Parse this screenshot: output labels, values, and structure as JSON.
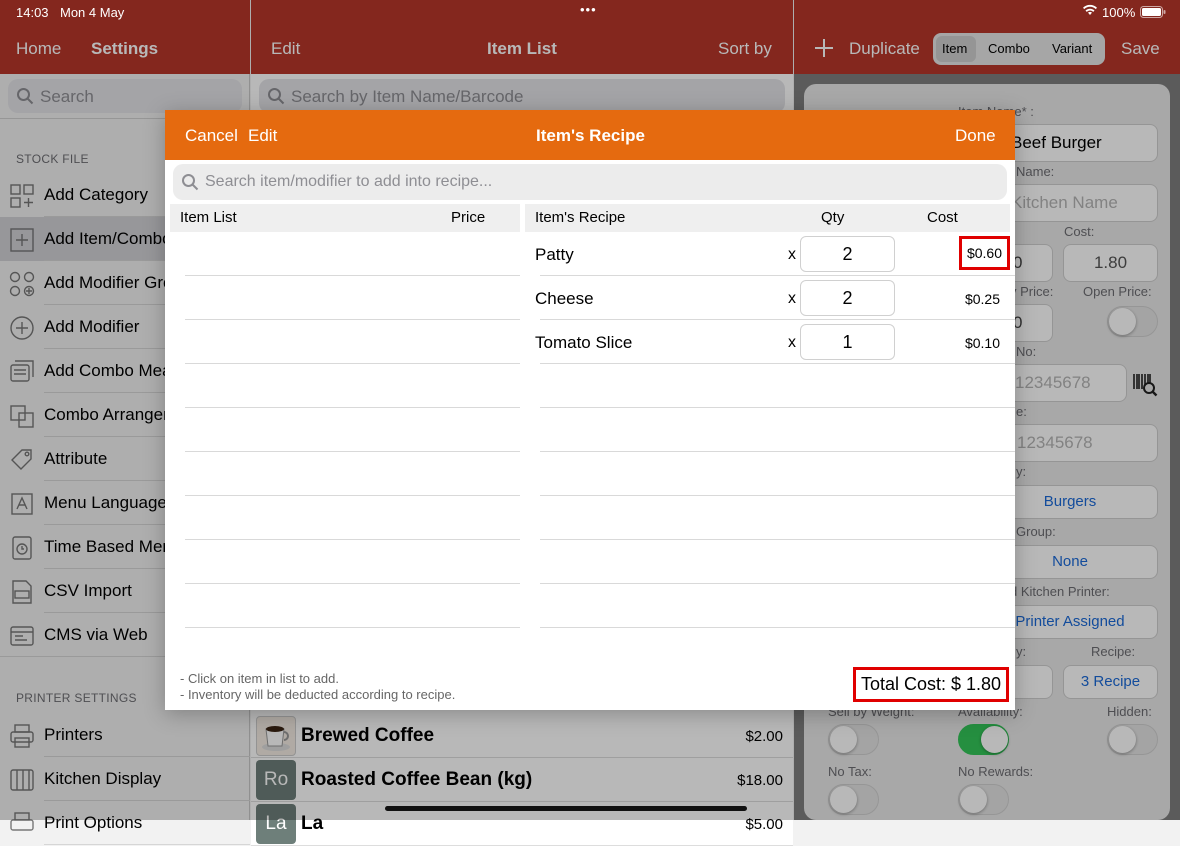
{
  "status": {
    "time": "14:03",
    "date": "Mon 4 May",
    "battery": "100%"
  },
  "header": {
    "home": "Home",
    "settings": "Settings",
    "edit": "Edit",
    "title": "Item List",
    "sort": "Sort by",
    "duplicate": "Duplicate",
    "seg": [
      "Item",
      "Combo",
      "Variant"
    ],
    "save": "Save"
  },
  "left": {
    "search_placeholder": "Search",
    "stock_title": "STOCK FILE",
    "stock_items": [
      {
        "label": "Add Category",
        "icon": "add-category-icon"
      },
      {
        "label": "Add Item/Combo",
        "icon": "plus-square-icon"
      },
      {
        "label": "Add Modifier Group",
        "icon": "modifier-group-icon"
      },
      {
        "label": "Add Modifier",
        "icon": "plus-circle-icon"
      },
      {
        "label": "Add Combo Meal",
        "icon": "combo-meal-icon"
      },
      {
        "label": "Combo Arrangement",
        "icon": "combo-arrange-icon"
      },
      {
        "label": "Attribute",
        "icon": "tag-icon"
      },
      {
        "label": "Menu Language",
        "icon": "language-icon"
      },
      {
        "label": "Time Based Menu",
        "icon": "timer-icon"
      },
      {
        "label": "CSV Import",
        "icon": "csv-icon"
      },
      {
        "label": "CMS via Web",
        "icon": "web-icon"
      }
    ],
    "printer_title": "PRINTER SETTINGS",
    "printer_items": [
      {
        "label": "Printers",
        "icon": "printer-icon"
      },
      {
        "label": "Kitchen Display",
        "icon": "kitchen-display-icon"
      },
      {
        "label": "Print Options",
        "icon": "print-options-icon"
      }
    ]
  },
  "middle": {
    "search_placeholder": "Search by Item Name/Barcode",
    "items": [
      {
        "thumb": "",
        "name": "Brewed Coffee",
        "price": "$2.00"
      },
      {
        "thumb": "Ro",
        "name": "Roasted Coffee Bean (kg)",
        "price": "$18.00"
      },
      {
        "thumb": "La",
        "name": "La",
        "price": "$5.00"
      }
    ]
  },
  "right": {
    "item_name_label": "Item Name* :",
    "item_name": "Beef Burger",
    "kitchen_name_label": "Name:",
    "kitchen_name_placeholder": "Kitchen Name",
    "cost_label": "Cost:",
    "price_value": "0",
    "cost_value": "1.80",
    "open_price_label": "Open Price:",
    "price_label2": "y Price:",
    "price_value2": "0",
    "barcode_label": "No:",
    "barcode_placeholder": "12345678",
    "sku_label": "e:",
    "sku_placeholder": "12345678",
    "category_label": "y:",
    "category": "Burgers",
    "modgroup_label": "Group:",
    "modgroup": "None",
    "printer_label": "d Kitchen Printer:",
    "printer": "Printer Assigned",
    "recipe_label": "Recipe:",
    "recipe": "3 Recipe",
    "qty_label": "y:",
    "sell_weight_label": "Sell by Weight:",
    "availability_label": "Availability:",
    "hidden_label": "Hidden:",
    "notax_label": "No Tax:",
    "norewards_label": "No Rewards:"
  },
  "modal": {
    "cancel": "Cancel",
    "edit": "Edit",
    "title": "Item's Recipe",
    "done": "Done",
    "search_placeholder": "Search item/modifier to add into recipe...",
    "left_header": "Item List",
    "price_header": "Price",
    "recipe_header": "Item's Recipe",
    "qty_header": "Qty",
    "cost_header": "Cost",
    "times": "x",
    "recipe": [
      {
        "name": "Patty",
        "qty": "2",
        "cost": "$0.60"
      },
      {
        "name": "Cheese",
        "qty": "2",
        "cost": "$0.25"
      },
      {
        "name": "Tomato Slice",
        "qty": "1",
        "cost": "$0.10"
      }
    ],
    "note1": "- Click on item in list to add.",
    "note2": "- Inventory will be deducted according to recipe.",
    "total": "Total Cost: $ 1.80"
  },
  "colors": {
    "header": "#b8362a",
    "modal_header": "#e56a0f",
    "highlight": "#e00000",
    "link": "#1b6ad8",
    "switch_on": "#34c759"
  }
}
